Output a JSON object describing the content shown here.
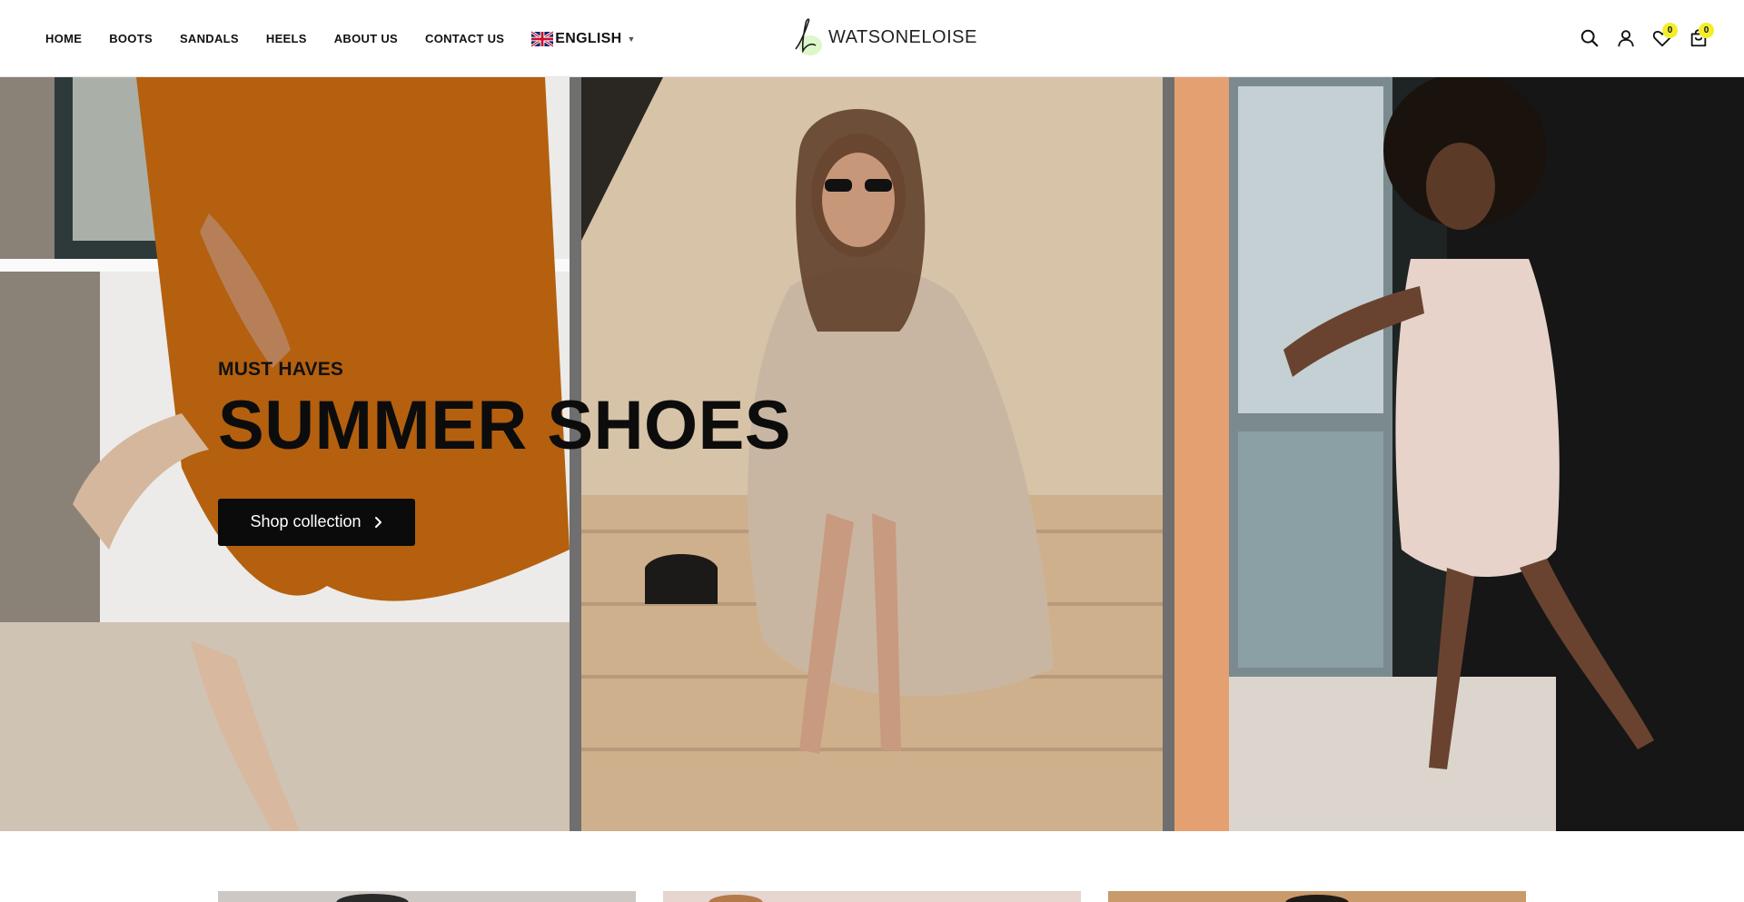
{
  "nav": {
    "items": [
      "HOME",
      "BOOTS",
      "SANDALS",
      "HEELS",
      "ABOUT US",
      "CONTACT US"
    ],
    "language": {
      "label": "ENGLISH",
      "flag_icon": "uk-flag-icon"
    }
  },
  "brand": {
    "name": "WATSONELOISE"
  },
  "header_icons": {
    "search_icon": "search-icon",
    "account_icon": "user-icon",
    "wishlist_icon": "heart-icon",
    "wishlist_count": "0",
    "cart_icon": "shopping-bag-icon",
    "cart_count": "0"
  },
  "hero": {
    "eyebrow": "MUST HAVES",
    "headline": "SUMMER SHOES",
    "cta_label": "Shop collection"
  },
  "colors": {
    "accent_badge": "#f2ee2a",
    "cta_bg": "#0b0b0b",
    "text": "#111111"
  }
}
